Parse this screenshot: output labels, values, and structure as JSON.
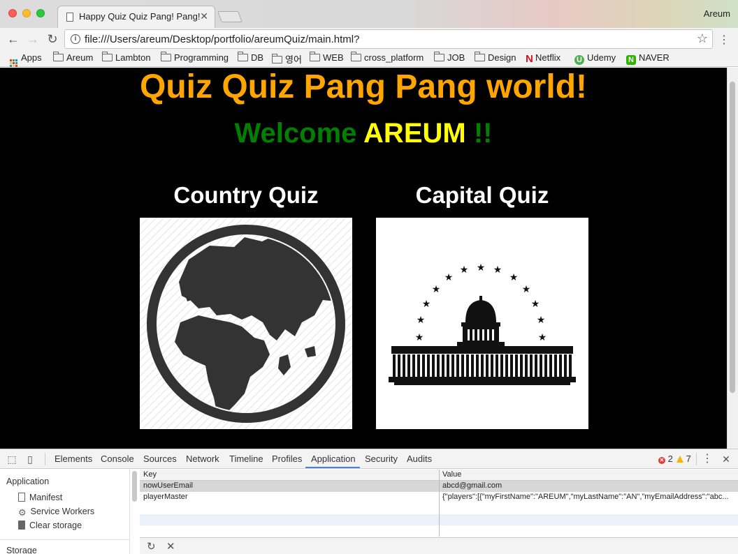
{
  "browser": {
    "tab_title": "Happy Quiz Quiz Pang! Pang!",
    "profile_name": "Areum",
    "url": "file:///Users/areum/Desktop/portfolio/areumQuiz/main.html?",
    "bookmarks": [
      "Apps",
      "Areum",
      "Lambton",
      "Programming",
      "DB",
      "영어",
      "WEB",
      "cross_platform",
      "JOB",
      "Design",
      "Netflix",
      "Udemy",
      "NAVER"
    ]
  },
  "page": {
    "title": "Quiz Quiz Pang Pang world!",
    "welcome_text": "Welcome",
    "user_name": "AREUM",
    "exclaim": "!!",
    "quizzes": [
      {
        "title": "Country Quiz",
        "icon": "globe-icon"
      },
      {
        "title": "Capital Quiz",
        "icon": "capitol-icon"
      }
    ],
    "colors": {
      "background": "#000000",
      "title": "#ffa500",
      "welcome": "#008000",
      "user": "#ffff00"
    }
  },
  "devtools": {
    "tabs": [
      "Elements",
      "Console",
      "Sources",
      "Network",
      "Timeline",
      "Profiles",
      "Application",
      "Security",
      "Audits"
    ],
    "active_tab": "Application",
    "error_count": "2",
    "warning_count": "7",
    "sidebar": {
      "heading": "Application",
      "items": [
        "Manifest",
        "Service Workers",
        "Clear storage"
      ],
      "storage_heading": "Storage"
    },
    "table": {
      "columns": [
        "Key",
        "Value"
      ],
      "rows": [
        {
          "key": "nowUserEmail",
          "value": "abcd@gmail.com"
        },
        {
          "key": "playerMaster",
          "value": "{\"players\":[{\"myFirstName\":\"AREUM\",\"myLastName\":\"AN\",\"myEmailAddress\":\"abc..."
        }
      ]
    }
  }
}
